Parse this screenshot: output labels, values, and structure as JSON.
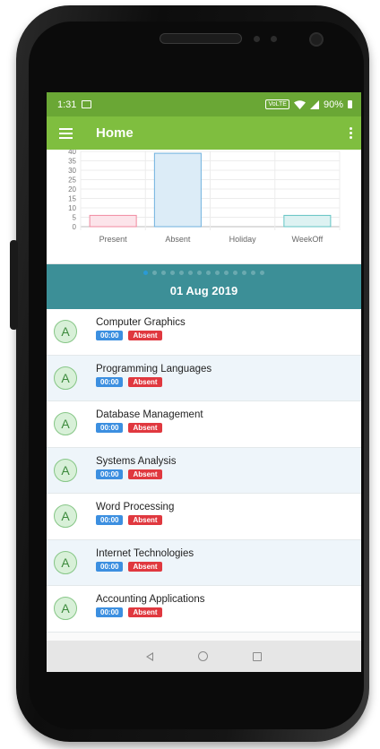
{
  "status": {
    "time": "1:31",
    "volte": "VoLTE",
    "battery": "90%"
  },
  "appbar": {
    "title": "Home"
  },
  "chart_data": {
    "type": "bar",
    "categories": [
      "Present",
      "Absent",
      "Holiday",
      "WeekOff"
    ],
    "values": [
      6,
      39,
      0,
      6
    ],
    "yticks": [
      0,
      5,
      10,
      15,
      20,
      25,
      30,
      35,
      40
    ],
    "ylim": [
      0,
      40
    ],
    "fills": [
      "#fce4ea",
      "#dcecf7",
      "#ffffff",
      "#ddf2f2"
    ],
    "strokes": [
      "#f08aa0",
      "#6fb1de",
      "#cccccc",
      "#62c4c4"
    ]
  },
  "date_panel": {
    "date": "01 Aug 2019",
    "page_count": 14,
    "active_page": 0
  },
  "records": [
    {
      "initial": "A",
      "subject": "Computer Graphics",
      "time": "00:00",
      "status": "Absent"
    },
    {
      "initial": "A",
      "subject": "Programming Languages",
      "time": "00:00",
      "status": "Absent"
    },
    {
      "initial": "A",
      "subject": "Database Management",
      "time": "00:00",
      "status": "Absent"
    },
    {
      "initial": "A",
      "subject": "Systems Analysis",
      "time": "00:00",
      "status": "Absent"
    },
    {
      "initial": "A",
      "subject": "Word Processing",
      "time": "00:00",
      "status": "Absent"
    },
    {
      "initial": "A",
      "subject": "Internet Technologies",
      "time": "00:00",
      "status": "Absent"
    },
    {
      "initial": "A",
      "subject": "Accounting Applications",
      "time": "00:00",
      "status": "Absent"
    }
  ],
  "colors": {
    "statusbar": "#6aa735",
    "appbar": "#7fbe3f",
    "date_panel": "#3c8f97",
    "time_badge": "#3c8fe0",
    "absent_badge": "#e0383f"
  }
}
